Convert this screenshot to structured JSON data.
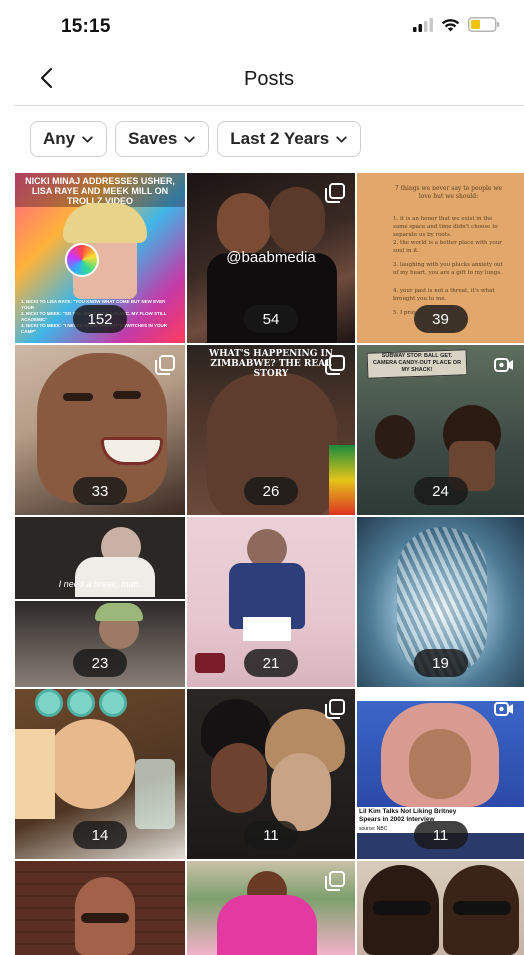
{
  "status": {
    "time": "15:15"
  },
  "nav": {
    "title": "Posts"
  },
  "filters": [
    {
      "label": "Any"
    },
    {
      "label": "Saves"
    },
    {
      "label": "Last 2 Years"
    }
  ],
  "posts": [
    {
      "count": "152",
      "type": "image",
      "caption": "NICKI MINAJ ADDRESSES USHER, LISA RAYE AND MEEK MILL ON TROLLZ VIDEO",
      "list": [
        "1. NICKI TO LISA RAYE: \"YOU KNOW WHAT COME BUT NEW EVEN YOUR",
        "2. NICKI TO MEEK: \"SO YOU WALK INTO A CLINIC. MY FLOW STILL ACADEMIC\"",
        "3. NICKI TO MEEK: \"I NEVER KNEW WHEN IT'S SWITCHES IN YOUR CAMP\""
      ],
      "colors": [
        "#d83a72",
        "#f4a23a"
      ]
    },
    {
      "count": "54",
      "type": "carousel",
      "watermark": "@baabmedia",
      "colors": [
        "#1d1616",
        "#7a5b4a"
      ]
    },
    {
      "count": "39",
      "type": "image",
      "title": "7 things we never say to people we love but we should:",
      "lines": [
        "1. it is an honor that we exist in the same space and time didn't choose to separate us by roots.",
        "2. the world is a better place with your soul in it.",
        "3. laughing with you plucks anxiety out of my heart, you are a gift to my lungs.",
        "4. your past is not a threat, it's what brought you to me.",
        "5. I pray..."
      ],
      "colors": [
        "#e2a76a",
        "#d89b5f"
      ]
    },
    {
      "count": "33",
      "type": "carousel",
      "colors": [
        "#c9b6a4",
        "#3b2a22"
      ]
    },
    {
      "count": "26",
      "type": "carousel",
      "caption": "WHAT'S HAPPENING IN ZIMBABWE? THE REAL STORY",
      "colors": [
        "#2a2420",
        "#6b4a3c"
      ]
    },
    {
      "count": "24",
      "type": "video",
      "caption": "SUBWAY STOP. BALL GET. CAMERA CANDY-OUT PLACE OR MY SHACK!",
      "colors": [
        "#576556",
        "#2d3a36"
      ]
    },
    {
      "count": "23",
      "type": "image",
      "subtitle": "I need a break, man.",
      "colors": [
        "#3a3634",
        "#8a7e76"
      ]
    },
    {
      "count": "21",
      "type": "image",
      "colors": [
        "#e6c6cf",
        "#8d6a5b"
      ]
    },
    {
      "count": "19",
      "type": "image",
      "colors": [
        "#2a4a62",
        "#9cc2d6"
      ]
    },
    {
      "count": "14",
      "type": "image",
      "colors": [
        "#7fd4c8",
        "#e9b98e"
      ]
    },
    {
      "count": "11",
      "type": "carousel",
      "colors": [
        "#2a2624",
        "#c9a386"
      ]
    },
    {
      "count": "11",
      "type": "video",
      "headline": "Lil Kim Talks Not Liking Britney Spears in 2002 Interview",
      "source": "source: NBC",
      "colors": [
        "#d99a92",
        "#2c4aa8"
      ]
    },
    {
      "count": "",
      "type": "image",
      "colors": [
        "#5a2f22",
        "#a2624a"
      ]
    },
    {
      "count": "",
      "type": "carousel",
      "colors": [
        "#e23aa0",
        "#f2b2c8"
      ]
    },
    {
      "count": "",
      "type": "image",
      "colors": [
        "#c7b3a3",
        "#222"
      ]
    }
  ]
}
